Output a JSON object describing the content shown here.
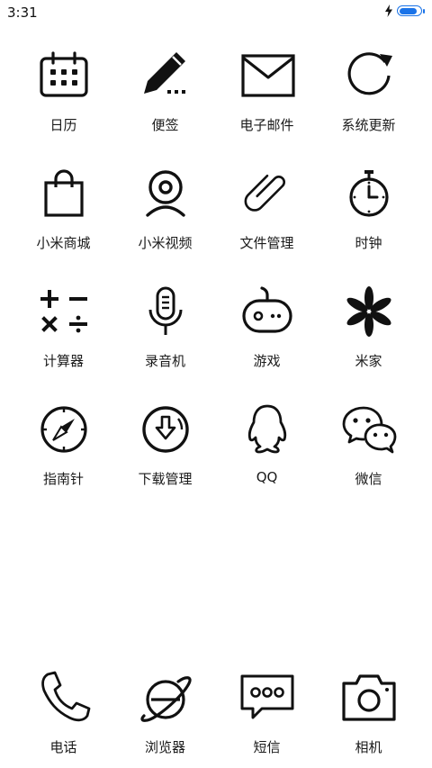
{
  "status": {
    "time": "3:31",
    "battery_level": 0.85
  },
  "apps": [
    {
      "label": "日历",
      "icon": "calendar-icon"
    },
    {
      "label": "便签",
      "icon": "notes-icon"
    },
    {
      "label": "电子邮件",
      "icon": "email-icon"
    },
    {
      "label": "系统更新",
      "icon": "update-icon"
    },
    {
      "label": "小米商城",
      "icon": "shopping-bag-icon"
    },
    {
      "label": "小米视频",
      "icon": "video-icon"
    },
    {
      "label": "文件管理",
      "icon": "file-manager-icon"
    },
    {
      "label": "时钟",
      "icon": "clock-icon"
    },
    {
      "label": "计算器",
      "icon": "calculator-icon"
    },
    {
      "label": "录音机",
      "icon": "recorder-icon"
    },
    {
      "label": "游戏",
      "icon": "game-icon"
    },
    {
      "label": "米家",
      "icon": "mijia-icon"
    },
    {
      "label": "指南针",
      "icon": "compass-icon"
    },
    {
      "label": "下载管理",
      "icon": "download-icon"
    },
    {
      "label": "QQ",
      "icon": "qq-icon"
    },
    {
      "label": "微信",
      "icon": "wechat-icon"
    }
  ],
  "dock": [
    {
      "label": "电话",
      "icon": "phone-icon"
    },
    {
      "label": "浏览器",
      "icon": "browser-icon"
    },
    {
      "label": "短信",
      "icon": "messages-icon"
    },
    {
      "label": "相机",
      "icon": "camera-icon"
    }
  ]
}
